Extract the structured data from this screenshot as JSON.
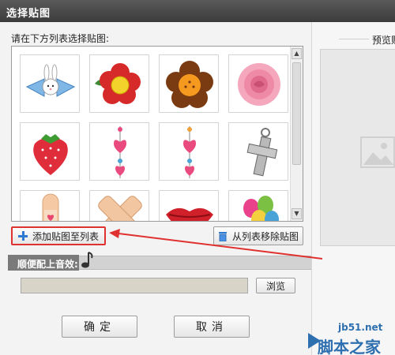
{
  "window": {
    "title": "选择贴图"
  },
  "sticker_list": {
    "prompt": "请在下方列表选择贴图:",
    "items": [
      {
        "name": "bunny-bow"
      },
      {
        "name": "red-flower"
      },
      {
        "name": "orange-flower"
      },
      {
        "name": "pink-rose"
      },
      {
        "name": "strawberry"
      },
      {
        "name": "heart-charm-chain"
      },
      {
        "name": "heart-charm-chain-2"
      },
      {
        "name": "silver-cross"
      },
      {
        "name": "bandage"
      },
      {
        "name": "bandage-cross"
      },
      {
        "name": "red-lips"
      },
      {
        "name": "balloons"
      }
    ]
  },
  "buttons": {
    "add": "添加贴图至列表",
    "remove": "从列表移除贴图",
    "browse": "浏览",
    "ok": "确定",
    "cancel": "取消"
  },
  "sound": {
    "label": "顺便配上音效:",
    "path_value": ""
  },
  "preview": {
    "label": "预览贴"
  },
  "watermark": {
    "url": "jb51.net",
    "brand": "脚本之家"
  },
  "colors": {
    "highlight": "#e03131",
    "titlebar": "#4a4a4a"
  },
  "icons": {
    "add": "plus-icon",
    "remove": "trash-icon",
    "note": "music-note-icon",
    "placeholder": "image-placeholder-icon"
  }
}
